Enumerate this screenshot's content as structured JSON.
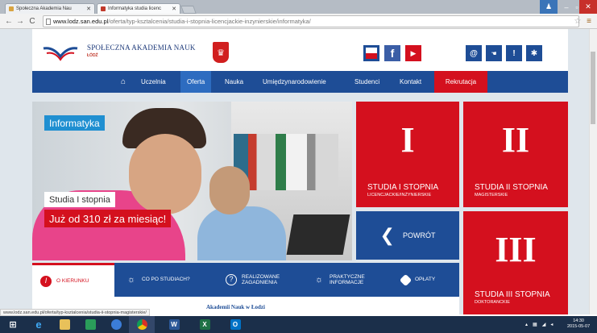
{
  "browser": {
    "tabs": [
      {
        "label": "Społeczna Akademia Nau",
        "active": false
      },
      {
        "label": "Informatyka studia licenc",
        "active": true
      }
    ],
    "url_host": "www.lodz.san.edu.pl",
    "url_path": "/oferta/typ-ksztalcenia/studia-i-stopnia-licencjackie-inzynierskie/informatyka/"
  },
  "header": {
    "logo_name": "SPOŁECZNA AKADEMIA NAUK",
    "logo_city": "ŁÓDŹ",
    "icons": [
      "flag-icon",
      "facebook-icon",
      "youtube-icon",
      "email-icon",
      "sign-language-icon",
      "alert-icon",
      "settings-icon"
    ],
    "colors": {
      "navy": "#1e4d96",
      "red": "#d4101e",
      "blue": "#1f8fd1"
    }
  },
  "nav": {
    "items": [
      "Uczelnia",
      "Oferta",
      "Nauka",
      "Umiędzynarodowienie",
      "Studenci",
      "Kontakt",
      "Rekrutacja"
    ],
    "active": "Oferta"
  },
  "hero": {
    "label": "Informatyka",
    "subtitle": "Studia I stopnia",
    "price": "Już od 310 zł za miesiąc!"
  },
  "tiles": [
    {
      "numeral": "I",
      "title": "STUDIA I STOPNIA",
      "subtitle": "LICENCJACKIE/INŻYNIERSKIE"
    },
    {
      "numeral": "II",
      "title": "STUDIA II STOPNIA",
      "subtitle": "MAGISTERSKIE"
    },
    {
      "numeral": "III",
      "title": "STUDIA III STOPNIA",
      "subtitle": "DOKTORANCKIE"
    }
  ],
  "back_button": "POWRÓT",
  "bottom_tabs": [
    {
      "label": "O KIERUNKU",
      "active": true
    },
    {
      "label": "CO PO STUDIACH?"
    },
    {
      "label": "REALIZOWANE ZAGADNIENIA"
    },
    {
      "label": "PRAKTYCZNE INFORMACJE"
    },
    {
      "label": "OPŁATY"
    }
  ],
  "below_text": "Akademii Nauk w Łodzi",
  "status_url": "www.lodz.san.edu.pl/oferta/typ-ksztalcenia/studia-ii-stopnia-magisterskie/",
  "clock": {
    "time": "14:30",
    "date": "2015-05-07"
  }
}
